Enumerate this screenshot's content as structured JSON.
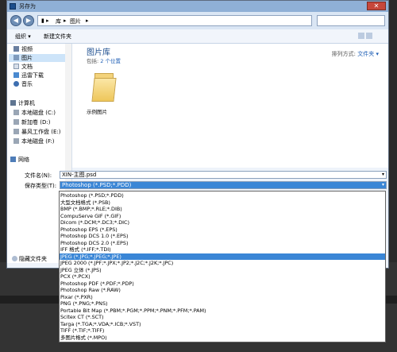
{
  "window": {
    "title": "另存为"
  },
  "address": {
    "path": [
      "库",
      "图片"
    ]
  },
  "toolbar": {
    "organize": "组织 ▾",
    "new_folder": "新建文件夹"
  },
  "sidebar": {
    "libraries": [
      "视频",
      "图片",
      "文档",
      "迅雷下载",
      "音乐"
    ],
    "computer": "计算机",
    "drives": [
      "本地磁盘 (C:)",
      "新加卷 (D:)",
      "暴风工作盘 (E:)",
      "本地磁盘 (F:)"
    ],
    "network": "网络"
  },
  "main": {
    "title": "图片库",
    "includes_prefix": "包括:",
    "includes_link": "2 个位置",
    "sort_prefix": "排列方式:",
    "sort_value": "文件夹 ▾",
    "folder_name": "示例图片"
  },
  "fields": {
    "filename_label": "文件名(N):",
    "filename_value": "XIN-主图.psd",
    "filetype_label": "保存类型(T):",
    "filetype_value": "Photoshop (*.PSD;*.PDD)"
  },
  "hide_folders": "隐藏文件夹",
  "file_types": [
    "Photoshop (*.PSD;*.PDD)",
    "大型文档格式 (*.PSB)",
    "BMP (*.BMP;*.RLE;*.DIB)",
    "CompuServe GIF (*.GIF)",
    "Dicom (*.DCM;*.DC3;*.DIC)",
    "Photoshop EPS (*.EPS)",
    "Photoshop DCS 1.0 (*.EPS)",
    "Photoshop DCS 2.0 (*.EPS)",
    "IFF 格式 (*.IFF;*.TDI)",
    "JPEG (*.JPG;*.JPEG;*.JPE)",
    "JPEG 2000 (*.JPF;*.JPX;*.JP2;*.J2C;*.J2K;*.JPC)",
    "JPEG 立体 (*.JPS)",
    "PCX (*.PCX)",
    "Photoshop PDF (*.PDF;*.PDP)",
    "Photoshop Raw (*.RAW)",
    "Pixar (*.PXR)",
    "PNG (*.PNG;*.PNS)",
    "Portable Bit Map (*.PBM;*.PGM;*.PPM;*.PNM;*.PFM;*.PAM)",
    "Scitex CT (*.SCT)",
    "Targa (*.TGA;*.VDA;*.ICB;*.VST)",
    "TIFF (*.TIF;*.TIFF)",
    "多图片格式 (*.MPO)"
  ],
  "highlighted_index": 9,
  "colors": {
    "selection": "#3a86d6",
    "link": "#1f5fb6"
  }
}
